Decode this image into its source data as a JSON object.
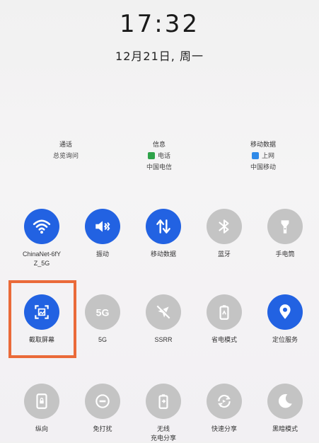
{
  "status": {
    "time": "17:32",
    "date": "12月21日, 周一"
  },
  "cards": [
    {
      "title": "通话",
      "line1": "总览询问"
    },
    {
      "title": "信息",
      "line1": "电话",
      "line2": "中国电信",
      "sim_color": "#2ea34a"
    },
    {
      "title": "移动数据",
      "line1": "上网",
      "line2": "中国移动",
      "sim_color": "#2f8ae8"
    }
  ],
  "tiles_row1": [
    {
      "label": "ChinaNet-6fY\nZ_5G",
      "icon": "wifi-icon",
      "active": true
    },
    {
      "label": "振动",
      "icon": "vibrate-icon",
      "active": true
    },
    {
      "label": "移动数据",
      "icon": "mobile-data-icon",
      "active": true
    },
    {
      "label": "蓝牙",
      "icon": "bluetooth-icon",
      "active": false
    },
    {
      "label": "手电筒",
      "icon": "flashlight-icon",
      "active": false
    }
  ],
  "tiles_row2": [
    {
      "label": "截取屏幕",
      "icon": "screenshot-icon",
      "active": true
    },
    {
      "label": "5G",
      "icon": "5g-icon",
      "active": false
    },
    {
      "label": "SSRR",
      "icon": "location-off-icon",
      "active": false
    },
    {
      "label": "省电模式",
      "icon": "battery-saver-icon",
      "active": false
    },
    {
      "label": "定位服务",
      "icon": "location-icon",
      "active": true
    }
  ],
  "tiles_row3": [
    {
      "label": "纵向",
      "icon": "portrait-lock-icon",
      "active": false
    },
    {
      "label": "免打扰",
      "icon": "do-not-disturb-icon",
      "active": false
    },
    {
      "label": "无线\n充电分享",
      "icon": "wireless-charge-icon",
      "active": false
    },
    {
      "label": "快速分享",
      "icon": "quick-share-icon",
      "active": false
    },
    {
      "label": "黑暗模式",
      "icon": "dark-mode-icon",
      "active": false
    }
  ],
  "colors": {
    "active": "#2262e2",
    "inactive": "#c4c4c4",
    "highlight": "#ea6a39"
  }
}
